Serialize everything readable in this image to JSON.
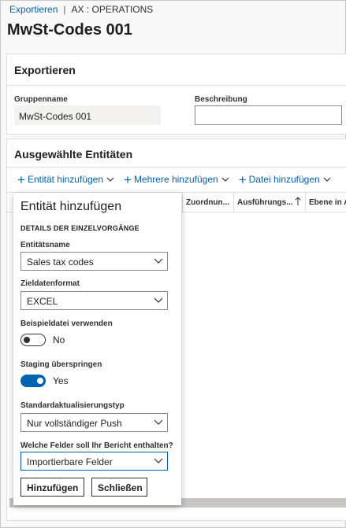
{
  "breadcrumb": {
    "link": "Exportieren",
    "separator": "|",
    "context": "AX : OPERATIONS"
  },
  "page_title": "MwSt-Codes 001",
  "export_card": {
    "header": "Exportieren",
    "group_name_label": "Gruppenname",
    "group_name_value": "MwSt-Codes 001",
    "description_label": "Beschreibung",
    "description_value": ""
  },
  "entities_card": {
    "header": "Ausgewählte Entitäten",
    "toolbar": {
      "add_entity": "Entität hinzufügen",
      "add_multiple": "Mehrere hinzufügen",
      "add_file": "Datei hinzufügen"
    },
    "columns": [
      "Zuordnun...",
      "Ausführungs...",
      "Ebene in A"
    ]
  },
  "flyout": {
    "title": "Entität hinzufügen",
    "section": "DETAILS DER EINZELVORGÄNGE",
    "entity_name_label": "Entitätsname",
    "entity_name_value": "Sales tax codes",
    "target_format_label": "Zieldatenformat",
    "target_format_value": "EXCEL",
    "sample_file_label": "Beispieldatei verwenden",
    "sample_file_state": "No",
    "skip_staging_label": "Staging überspringen",
    "skip_staging_state": "Yes",
    "update_type_label": "Standardaktualisierungstyp",
    "update_type_value": "Nur vollständiger Push",
    "fields_label": "Welche Felder soll Ihr Bericht enthalten?",
    "fields_value": "Importierbare Felder",
    "add_button": "Hinzufügen",
    "close_button": "Schließen"
  },
  "colors": {
    "accent": "#0063b1",
    "text": "#201f1e",
    "border": "#8a8886"
  }
}
